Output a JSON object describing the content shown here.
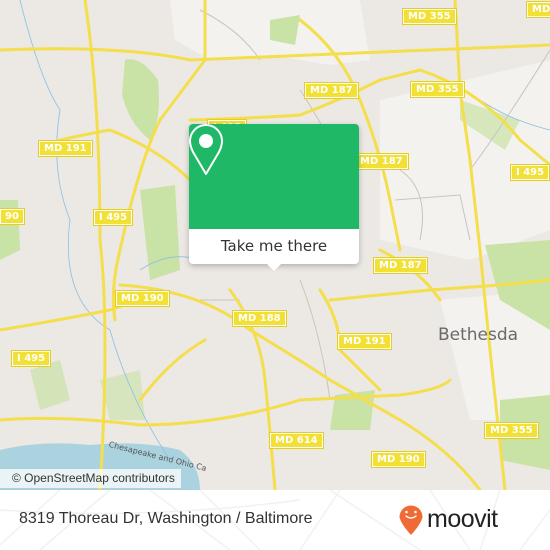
{
  "map": {
    "place_labels": [
      {
        "id": "bethesda",
        "text": "Bethesda"
      }
    ],
    "road_shields": [
      {
        "id": "md355-top",
        "text": "MD 355"
      },
      {
        "id": "md187-top",
        "text": "MD 187"
      },
      {
        "id": "md355-mid",
        "text": "MD 355"
      },
      {
        "id": "md-edge",
        "text": "MD"
      },
      {
        "id": "md191-left",
        "text": "MD 191"
      },
      {
        "id": "i495-hidden",
        "text": "I 495"
      },
      {
        "id": "md187-right",
        "text": "MD 187"
      },
      {
        "id": "i495-right",
        "text": "I 495"
      },
      {
        "id": "md190-edge",
        "text": "90"
      },
      {
        "id": "i495-left",
        "text": "I 495"
      },
      {
        "id": "md187-lower",
        "text": "MD 187"
      },
      {
        "id": "md190-left",
        "text": "MD 190"
      },
      {
        "id": "md188",
        "text": "MD 188"
      },
      {
        "id": "md191-mid",
        "text": "MD 191"
      },
      {
        "id": "i495-far-left",
        "text": "I 495"
      },
      {
        "id": "md355-bottom",
        "text": "MD 355"
      },
      {
        "id": "md614",
        "text": "MD 614"
      },
      {
        "id": "md190-bottom",
        "text": "MD 190"
      }
    ],
    "waterway_label": "Chesapeake and Ohio Ca",
    "attribution": "© OpenStreetMap contributors",
    "colors": {
      "land": "#ece8e4",
      "park": "#c9e3a6",
      "water": "#aad3df",
      "road": "#f5de4b",
      "brand_green": "#1fb866",
      "brand_orange": "#f06a35"
    }
  },
  "popup": {
    "icon": "map-pin-icon",
    "button_label": "Take me there"
  },
  "footer": {
    "address": "8319 Thoreau Dr, Washington / Baltimore",
    "brand": "moovit",
    "brand_icon": "moovit-smiley-pin-icon"
  }
}
